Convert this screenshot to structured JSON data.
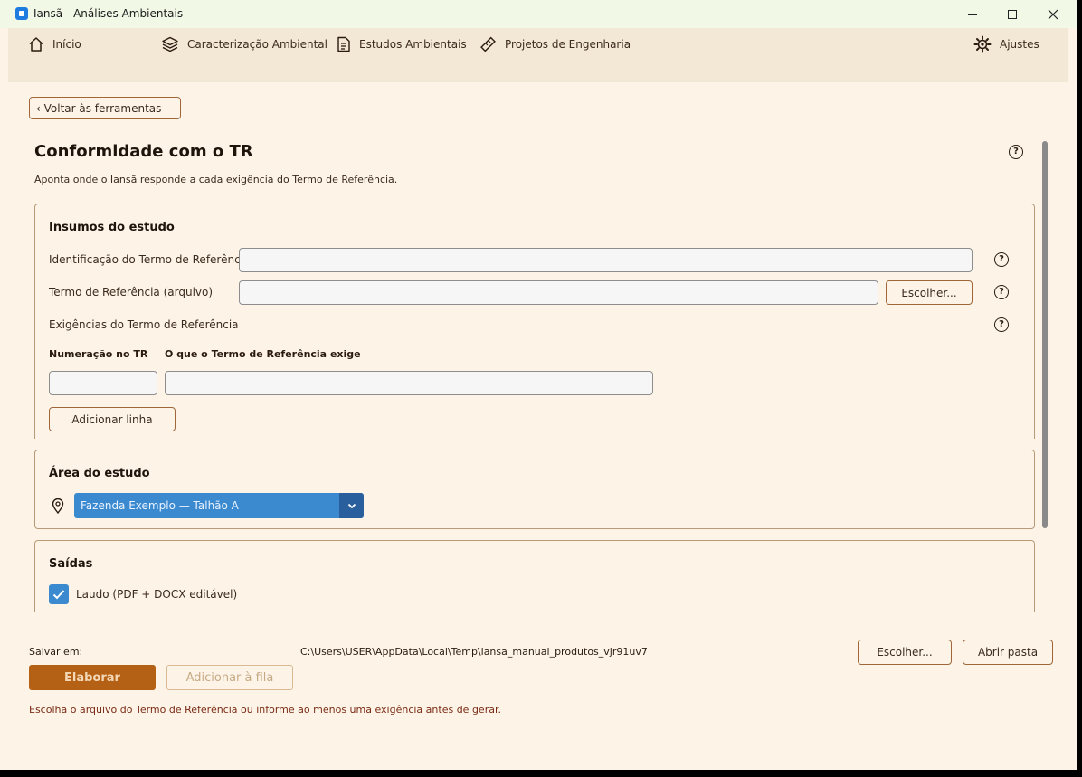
{
  "window": {
    "title": "Iansã - Análises Ambientais"
  },
  "nav": {
    "items": [
      {
        "label": "Início",
        "icon": "home-icon"
      },
      {
        "label": "Caracterização Ambiental",
        "icon": "layers-icon"
      },
      {
        "label": "Estudos Ambientais",
        "icon": "document-icon"
      },
      {
        "label": "Projetos de Engenharia",
        "icon": "ruler-icon"
      }
    ],
    "settings_label": "Ajustes"
  },
  "back_label": "‹ Voltar às ferramentas",
  "page": {
    "title": "Conformidade com o TR",
    "description": "Aponta onde o Iansã responde a cada exigência do Termo de Referência."
  },
  "inputs_card": {
    "title": "Insumos do estudo",
    "tr_id_label": "Identificação do Termo de Referência",
    "tr_id_value": "",
    "tr_file_label": "Termo de Referência (arquivo)",
    "tr_file_value": "",
    "choose_label": "Escolher...",
    "requirements_label": "Exigências do Termo de Referência",
    "col_num": "Numeração no TR",
    "col_req": "O que o Termo de Referência exige",
    "add_row_label": "Adicionar linha"
  },
  "area_card": {
    "title": "Área do estudo",
    "selected": "Fazenda Exemplo — Talhão A"
  },
  "outputs_card": {
    "title": "Saídas",
    "checkbox_label": "Laudo (PDF + DOCX editável)",
    "checked": true
  },
  "footer": {
    "save_label": "Salvar em:",
    "save_path": "C:\\Users\\USER\\AppData\\Local\\Temp\\iansa_manual_produtos_vjr91uv7",
    "choose_label": "Escolher...",
    "open_folder_label": "Abrir pasta",
    "generate_label": "Elaborar",
    "queue_label": "Adicionar à fila",
    "message": "Escolha o arquivo do Termo de Referência ou informe ao menos uma exigência antes de gerar."
  },
  "colors": {
    "background": "#fdf4e7",
    "nav_background": "#f3e7d5",
    "accent": "#b56115",
    "select_blue": "#3b8ad0",
    "error_text": "#7a2a14"
  }
}
